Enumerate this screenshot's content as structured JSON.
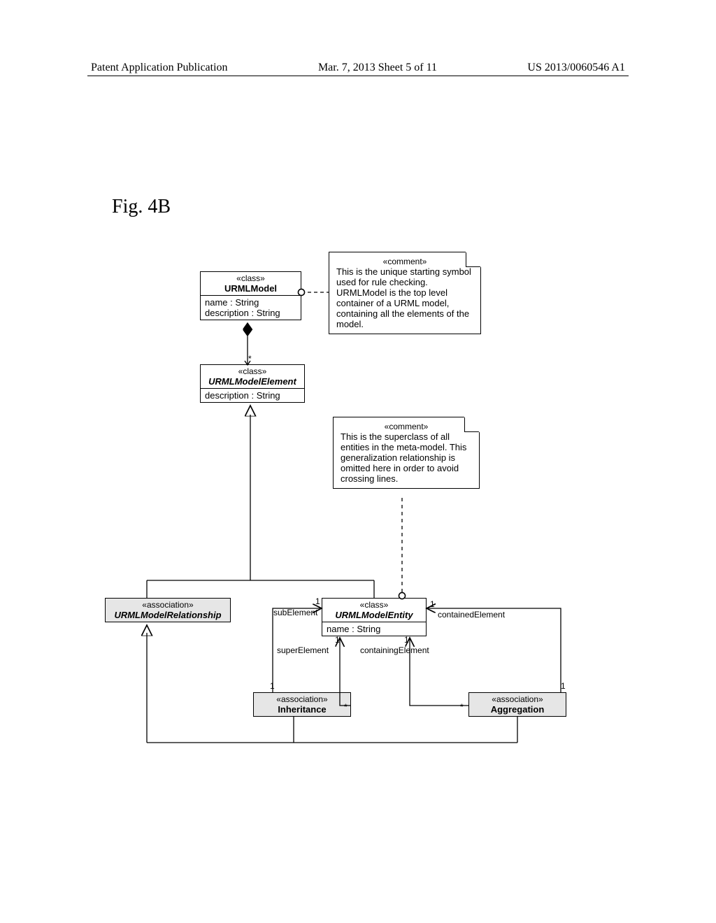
{
  "header": {
    "left": "Patent Application Publication",
    "center": "Mar. 7, 2013  Sheet 5 of 11",
    "right": "US 2013/0060546 A1"
  },
  "figureLabel": "Fig. 4B",
  "classes": {
    "urmlModel": {
      "stereo": "«class»",
      "name": "URMLModel",
      "attrs": [
        "name : String",
        "description : String"
      ]
    },
    "urmlModelElement": {
      "stereo": "«class»",
      "name": "URMLModelElement",
      "attrs": [
        "description : String"
      ]
    },
    "urmlModelRelationship": {
      "stereo": "«association»",
      "name": "URMLModelRelationship",
      "attrs": []
    },
    "urmlModelEntity": {
      "stereo": "«class»",
      "name": "URMLModelEntity",
      "attrs": [
        "name : String"
      ]
    },
    "inheritance": {
      "stereo": "«association»",
      "name": "Inheritance",
      "attrs": []
    },
    "aggregation": {
      "stereo": "«association»",
      "name": "Aggregation",
      "attrs": []
    }
  },
  "comments": {
    "top": {
      "stereo": "«comment»",
      "text": "This is the unique starting symbol used for rule checking. URMLModel is the top level container of a URML model, containing all the elements of the model."
    },
    "mid": {
      "stereo": "«comment»",
      "text": "This is the superclass of all entities in the meta-model. This generalization relationship is omitted here in order to avoid crossing lines."
    }
  },
  "labels": {
    "subElement": "subElement",
    "superElement": "superElement",
    "containedElement": "containedElement",
    "containingElement": "containingElement",
    "one": "1",
    "star": "*"
  }
}
